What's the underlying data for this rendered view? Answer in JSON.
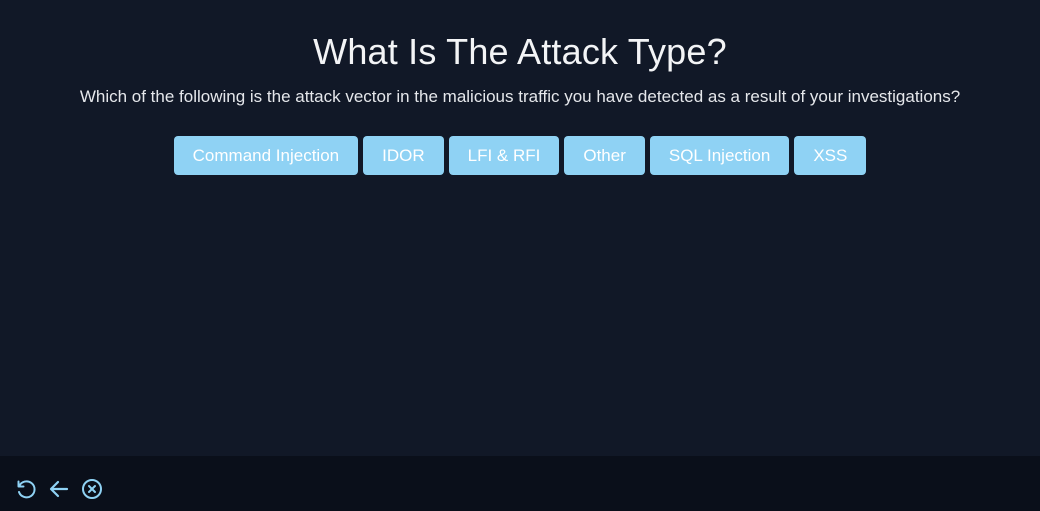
{
  "quiz": {
    "title": "What Is The Attack Type?",
    "question": "Which of the following is the attack vector in the malicious traffic you have detected as a result of your investigations?",
    "options": [
      {
        "label": "Command Injection"
      },
      {
        "label": "IDOR"
      },
      {
        "label": "LFI & RFI"
      },
      {
        "label": "Other"
      },
      {
        "label": "SQL Injection"
      },
      {
        "label": "XSS"
      }
    ]
  },
  "footer": {
    "controls": [
      {
        "icon": "refresh-icon"
      },
      {
        "icon": "back-arrow-icon"
      },
      {
        "icon": "close-circle-icon"
      }
    ]
  },
  "colors": {
    "background": "#111827",
    "footer_background": "#0a0f1a",
    "button_background": "#8fd2f4",
    "button_text": "#ffffff",
    "icon": "#8fd2f4"
  }
}
